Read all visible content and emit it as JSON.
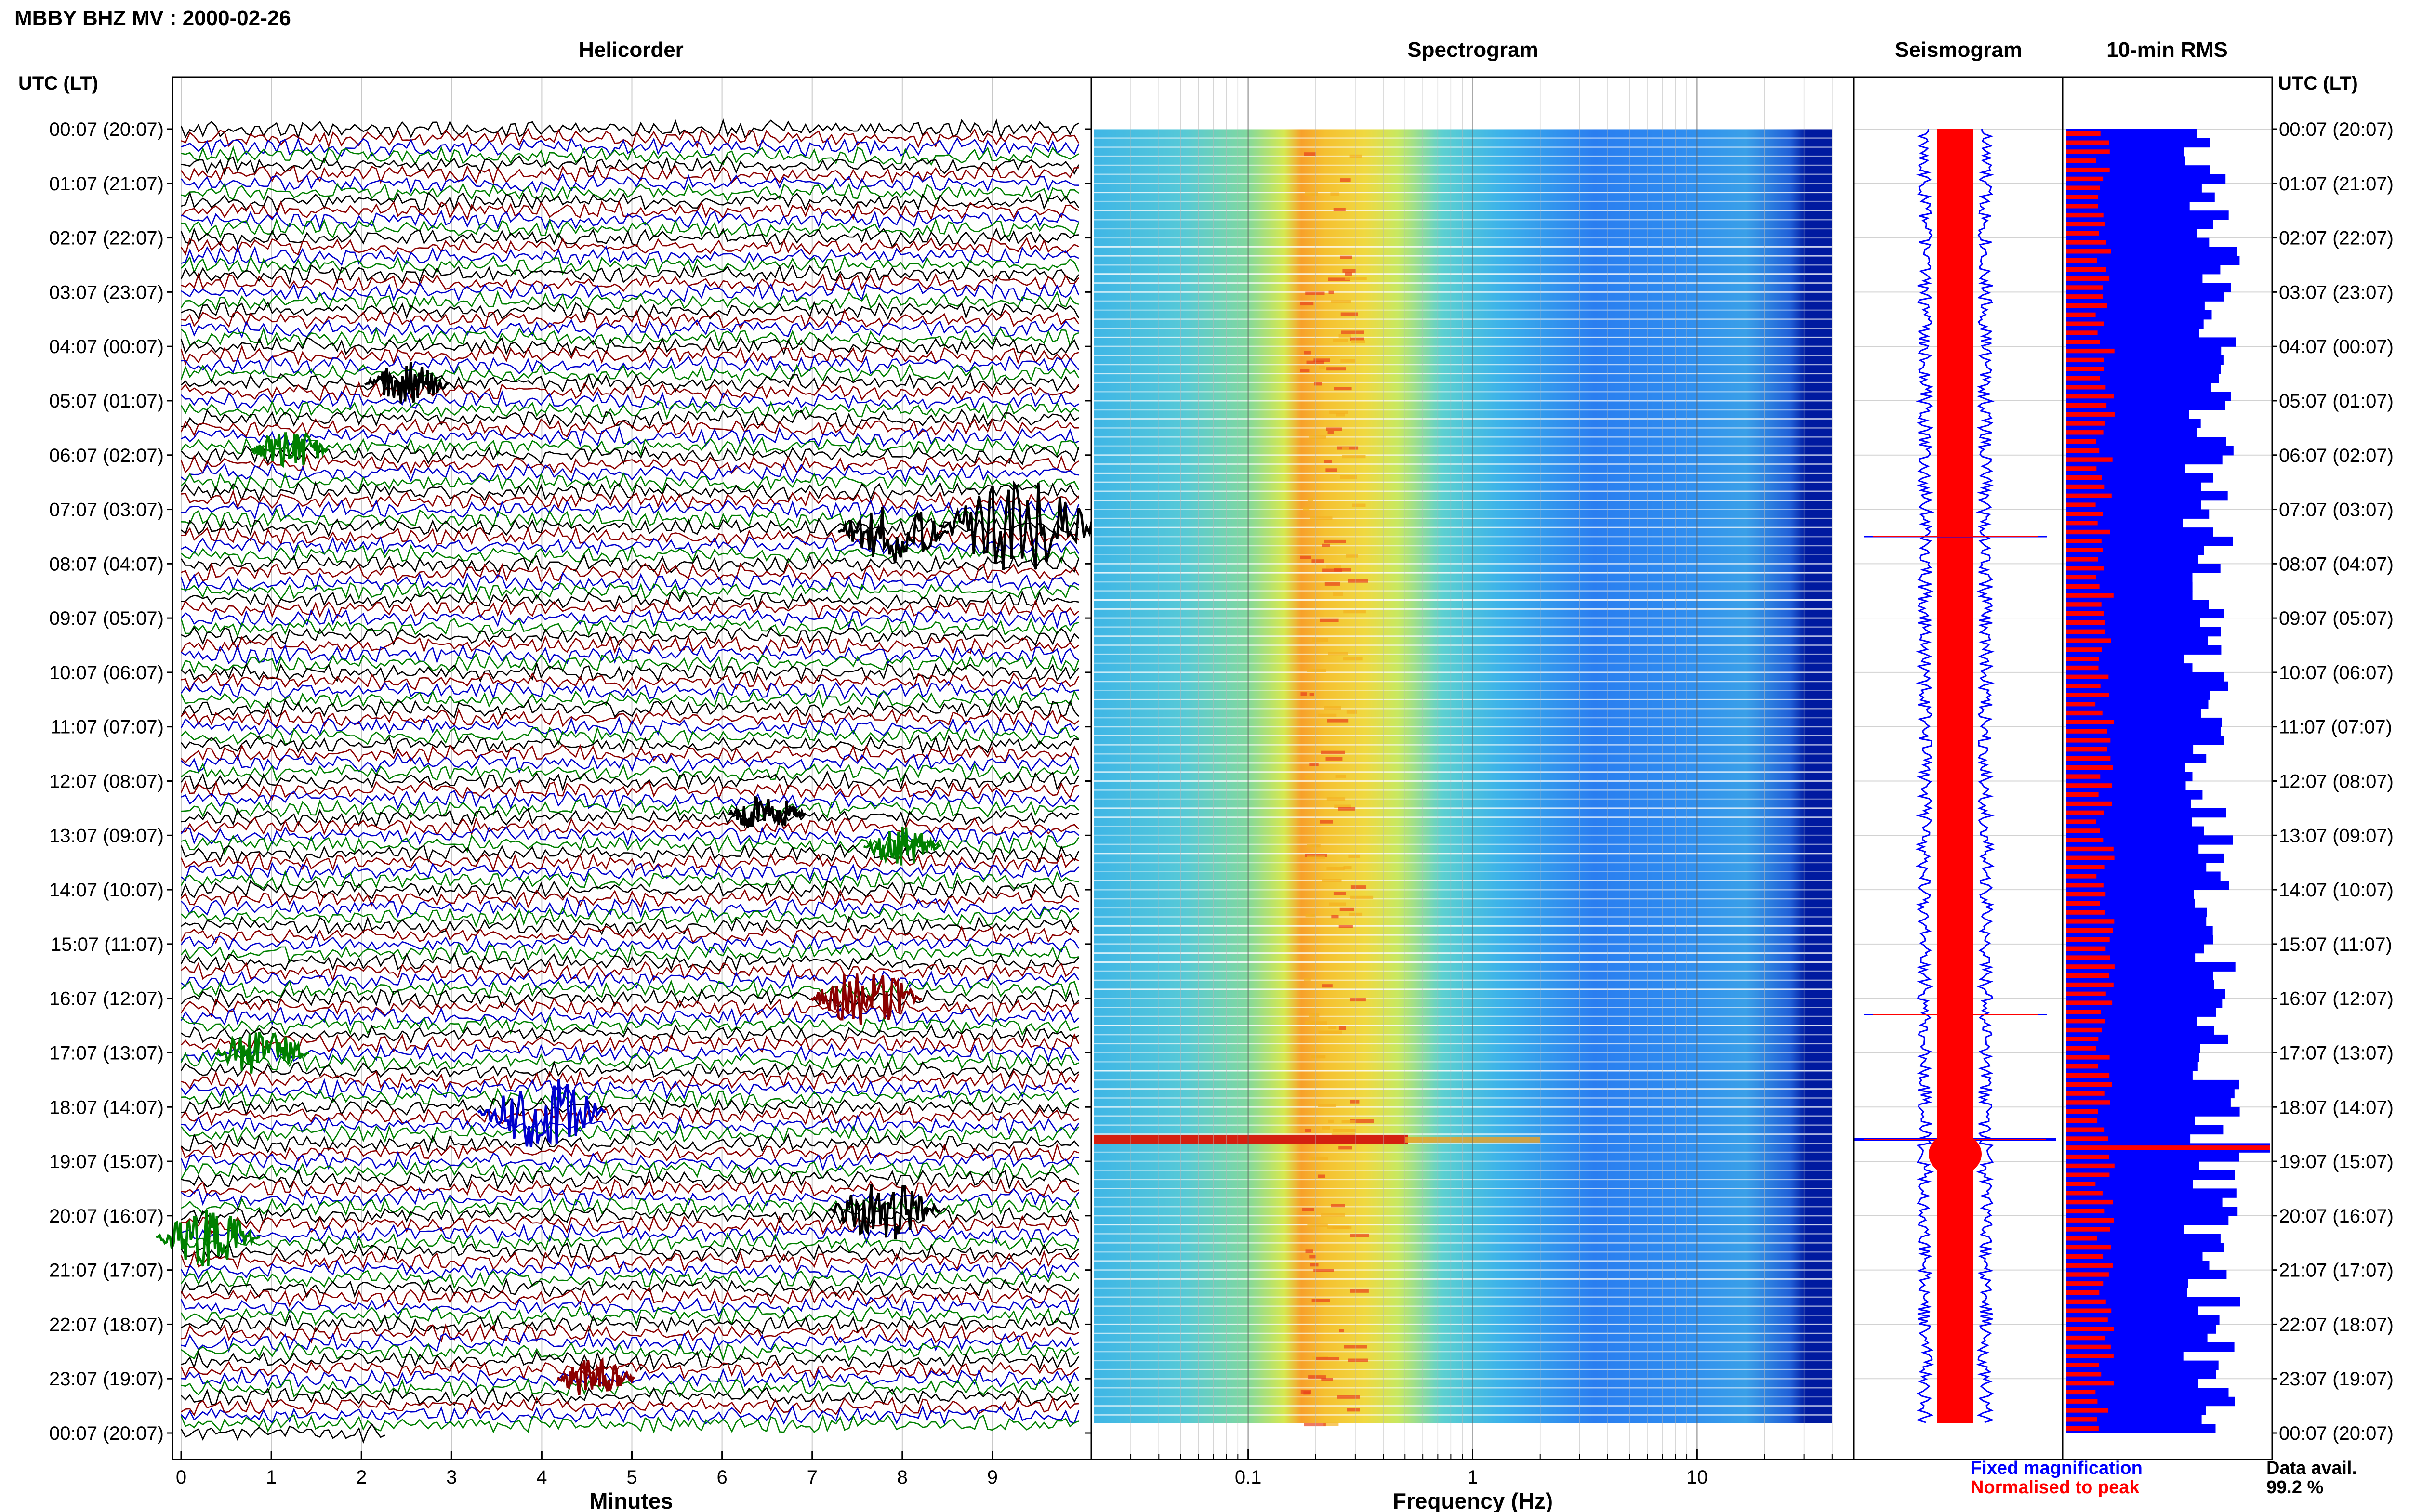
{
  "page_title": "MBBY BHZ MV : 2000-02-26",
  "axis_left_label": "UTC (LT)",
  "axis_right_label": "UTC (LT)",
  "panels": {
    "helicorder": "Helicorder",
    "spectrogram": "Spectrogram",
    "seismogram": "Seismogram",
    "rms": "10-min RMS"
  },
  "xlabels": {
    "helicorder": "Minutes",
    "spectrogram": "Frequency (Hz)"
  },
  "legend": {
    "fixed": "Fixed magnification",
    "normalised": "Normalised to peak"
  },
  "data_avail": {
    "label": "Data avail.",
    "value": "99.2 %"
  },
  "colors": {
    "fixed": "#0000ff",
    "normalised": "#ff0000",
    "traces": [
      "#000000",
      "#8b0000",
      "#0000cd",
      "#008000"
    ]
  },
  "chart_data": [
    {
      "type": "line",
      "name": "helicorder",
      "time_labels": [
        "00:07 (20:07)",
        "01:07 (21:07)",
        "02:07 (22:07)",
        "03:07 (23:07)",
        "04:07 (00:07)",
        "05:07 (01:07)",
        "06:07 (02:07)",
        "07:07 (03:07)",
        "08:07 (04:07)",
        "09:07 (05:07)",
        "10:07 (06:07)",
        "11:07 (07:07)",
        "12:07 (08:07)",
        "13:07 (09:07)",
        "14:07 (10:07)",
        "15:07 (11:07)",
        "16:07 (12:07)",
        "17:07 (13:07)",
        "18:07 (14:07)",
        "19:07 (15:07)",
        "20:07 (16:07)",
        "21:07 (17:07)",
        "22:07 (18:07)",
        "23:07 (19:07)",
        "00:07 (20:07)"
      ],
      "xlim": [
        0,
        10
      ],
      "x_ticks": [
        0,
        1,
        2,
        3,
        4,
        5,
        6,
        7,
        8,
        9
      ],
      "lines_per_hour": 6,
      "events": [
        {
          "hour": 4.7,
          "minute": 2.5,
          "color": "#000000",
          "amp": 1.2
        },
        {
          "hour": 5.9,
          "minute": 1.2,
          "color": "#008000",
          "amp": 1.0
        },
        {
          "hour": 7.3,
          "minute": 9.3,
          "color": "#000000",
          "amp": 3.5
        },
        {
          "hour": 7.4,
          "minute": 7.9,
          "color": "#000000",
          "amp": 2.0
        },
        {
          "hour": 12.6,
          "minute": 6.5,
          "color": "#000000",
          "amp": 1.0
        },
        {
          "hour": 13.2,
          "minute": 8.0,
          "color": "#008000",
          "amp": 1.0
        },
        {
          "hour": 16.0,
          "minute": 7.6,
          "color": "#8b0000",
          "amp": 2.0
        },
        {
          "hour": 17.0,
          "minute": 0.9,
          "color": "#008000",
          "amp": 1.5
        },
        {
          "hour": 18.1,
          "minute": 4.0,
          "color": "#0000cd",
          "amp": 2.5
        },
        {
          "hour": 19.9,
          "minute": 7.8,
          "color": "#000000",
          "amp": 2.0
        },
        {
          "hour": 20.4,
          "minute": 0.3,
          "color": "#008000",
          "amp": 1.8
        },
        {
          "hour": 23.0,
          "minute": 4.6,
          "color": "#8b0000",
          "amp": 1.0
        }
      ]
    },
    {
      "type": "heatmap",
      "name": "spectrogram",
      "x_scale": "log",
      "xlim": [
        0.02,
        50
      ],
      "x_ticks": [
        0.1,
        1,
        10
      ],
      "x_tick_labels": [
        "0.1",
        "1",
        "10"
      ],
      "peak_band_hz": [
        0.17,
        0.5
      ],
      "event_hour": 18.6
    },
    {
      "type": "line",
      "name": "seismogram",
      "events_hour": [
        7.5,
        16.3,
        18.6
      ]
    },
    {
      "type": "bar",
      "name": "10-min RMS",
      "orientation": "horizontal",
      "series": [
        {
          "name": "Fixed magnification",
          "color": "#0000ff"
        },
        {
          "name": "Normalised to peak",
          "color": "#ff0000"
        }
      ],
      "spike_hour": 18.6
    }
  ]
}
